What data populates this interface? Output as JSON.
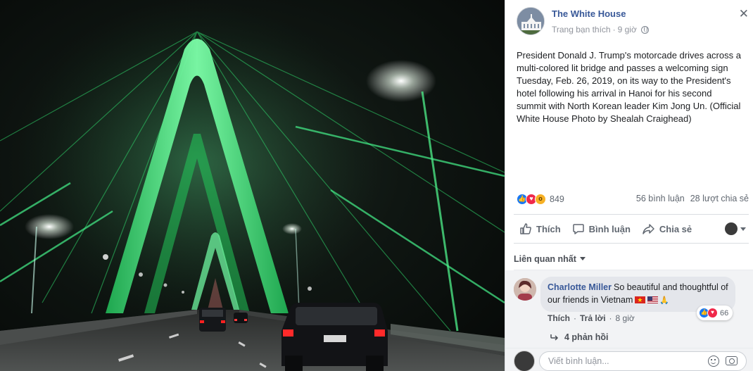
{
  "post": {
    "page_name": "The White House",
    "audience": "Trang bạn thích",
    "time": "9 giờ",
    "caption": "President Donald J. Trump's motorcade drives across a multi-colored lit bridge and passes a welcoming sign Tuesday, Feb. 26, 2019, on its way to the President's hotel following his arrival in Hanoi for his second summit with North Korean leader Kim Jong Un. (Official White House Photo by Shealah Craighead)",
    "close_label": "✕"
  },
  "stats": {
    "reaction_icons": [
      "like-icon",
      "love-icon",
      "wow-icon"
    ],
    "reaction_count": "849",
    "comments": "56 bình luận",
    "shares": "28 lượt chia sẻ"
  },
  "actions": {
    "like": "Thích",
    "comment": "Bình luận",
    "share": "Chia sẻ"
  },
  "sort_label": "Liên quan nhất",
  "comment": {
    "author": "Charlotte Miller",
    "text": "So beautiful and thoughtful of our friends in Vietnam",
    "emoji": [
      "vietnam-flag-icon",
      "us-flag-icon",
      "pray-icon"
    ],
    "reaction_count": "66",
    "like": "Thích",
    "reply": "Trả lời",
    "separator": "·",
    "time": "8 giờ",
    "replies": "4 phản hồi"
  },
  "composer": {
    "placeholder": "Viết bình luận..."
  },
  "colors": {
    "link_blue": "#385898",
    "like_blue": "#1877f2",
    "love_red": "#f0284a",
    "bridge_green": "#38e07a"
  }
}
